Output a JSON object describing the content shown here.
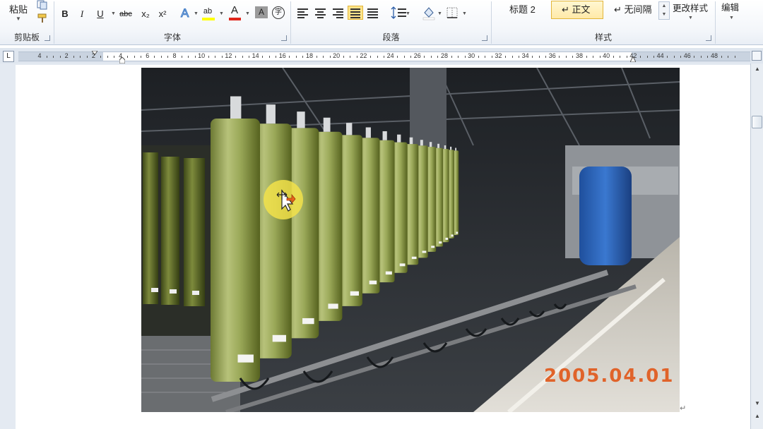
{
  "ribbon": {
    "clipboard": {
      "paste_label": "粘贴",
      "group_label": "剪贴板"
    },
    "font": {
      "group_label": "字体",
      "bold": "B",
      "italic": "I",
      "underline": "U",
      "strike": "abc",
      "subscript": "x₂",
      "superscript": "x²",
      "highlight_letter": "ab",
      "font_color_letter": "A",
      "char_shade_letter": "A",
      "enclose_char": "字",
      "highlight_color": "#ffff00",
      "font_color": "#e0251b"
    },
    "paragraph": {
      "group_label": "段落"
    },
    "styles": {
      "group_label": "样式",
      "items": [
        "标题 2",
        "↵ 正文",
        "↵ 无间隔"
      ],
      "selected_index": 1,
      "change_styles": "更改样式"
    },
    "editing": {
      "label": "编辑"
    }
  },
  "ruler": {
    "corner_symbol": "L",
    "numbers": [
      "4",
      "2",
      "2",
      "4",
      "6",
      "8",
      "10",
      "12",
      "14",
      "16",
      "18",
      "20",
      "22",
      "24",
      "26",
      "28",
      "30",
      "32",
      "34",
      "36",
      "38",
      "40",
      "42",
      "44",
      "46",
      "48"
    ]
  },
  "document": {
    "photo_date_stamp": "2005.04.01",
    "paragraph_mark": "↵"
  },
  "colors": {
    "accent_selected": "#ffe48a",
    "date_stamp": "#e0632a"
  }
}
